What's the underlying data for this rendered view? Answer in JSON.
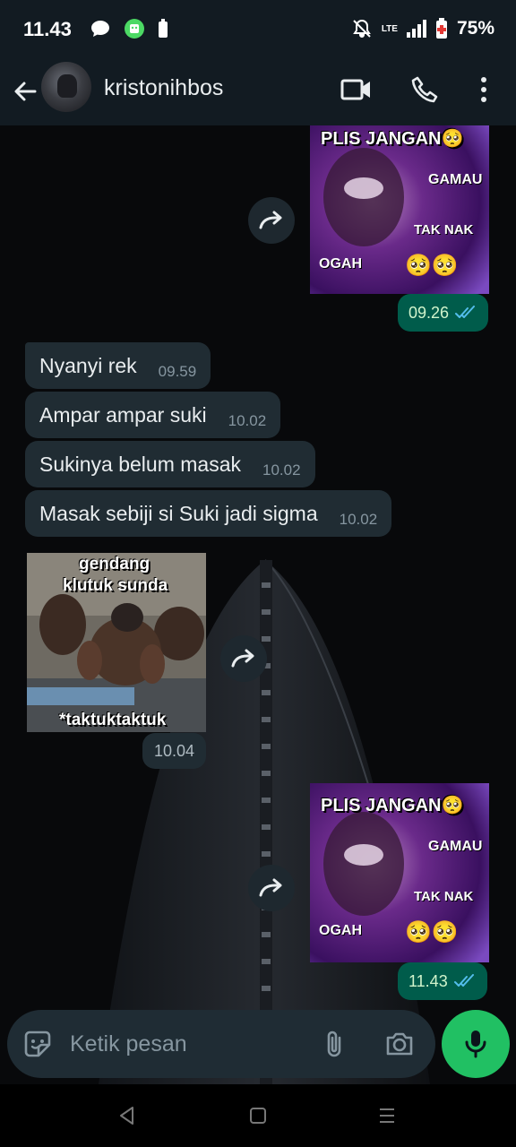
{
  "status_bar": {
    "time": "11.43",
    "network_label": "LTE",
    "battery_percent": "75%"
  },
  "header": {
    "contact_name": "kristonihbos",
    "icons": [
      "back-arrow-icon",
      "video-call-icon",
      "voice-call-icon",
      "more-options-icon"
    ]
  },
  "messages": [
    {
      "direction": "outgoing",
      "type": "image",
      "image_text": [
        "PLIS JANGAN",
        "GAMAU",
        "TAK NAK",
        "OGAH"
      ],
      "emoji": "🥺",
      "time": "09.26",
      "status": "read"
    },
    {
      "direction": "incoming",
      "type": "text",
      "text": "Nyanyi rek",
      "time": "09.59"
    },
    {
      "direction": "incoming",
      "type": "text",
      "text": "Ampar ampar suki",
      "time": "10.02"
    },
    {
      "direction": "incoming",
      "type": "text",
      "text": "Sukinya belum masak",
      "time": "10.02"
    },
    {
      "direction": "incoming",
      "type": "text",
      "text": "Masak sebiji si Suki jadi sigma",
      "time": "10.02"
    },
    {
      "direction": "incoming",
      "type": "image",
      "image_text": [
        "gendang",
        "klutuk sunda",
        "*taktuktaktuk"
      ],
      "time": "10.04"
    },
    {
      "direction": "outgoing",
      "type": "image",
      "image_text": [
        "PLIS JANGAN",
        "GAMAU",
        "TAK NAK",
        "OGAH"
      ],
      "emoji": "🥺",
      "time": "11.43",
      "status": "read"
    }
  ],
  "composer": {
    "placeholder": "Ketik pesan"
  },
  "colors": {
    "outgoing_bubble": "#005c4b",
    "incoming_bubble": "#202c33",
    "mic_button": "#21c063",
    "read_ticks": "#53bdeb"
  }
}
